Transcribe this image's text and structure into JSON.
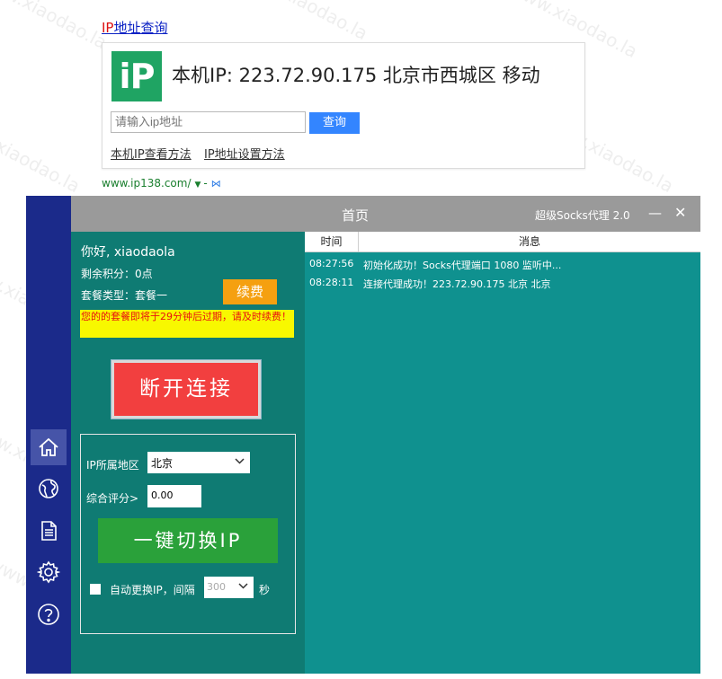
{
  "ip_page": {
    "title_prefix": "IP",
    "title_rest": "地址查询",
    "logo": "iP",
    "result": "本机IP: 223.72.90.175  北京市西城区 移动",
    "placeholder": "请输入ip地址",
    "query_label": "查询",
    "help_links": [
      "本机IP查看方法",
      "IP地址设置方法"
    ],
    "source_url": "www.ip138.com/",
    "source_sep": "-"
  },
  "app": {
    "title": "首页",
    "app_name": "超级Socks代理 2.0",
    "minimize": "—",
    "close": "✕",
    "greeting": "你好, xiaodaola",
    "points": "剩余积分：0点",
    "plan": "套餐类型：套餐一",
    "renew": "续费",
    "warning": "您的的套餐即将于29分钟后过期，请及时续费！",
    "disconnect": "断开连接",
    "region_label": "IP所属地区",
    "region_value": "北京",
    "score_label": "综合评分>",
    "score_value": "0.00",
    "switch_ip": "一键切换IP",
    "auto_label": "自动更换IP，间隔",
    "interval_value": "300",
    "seconds": "秒",
    "nav": [
      "home-icon",
      "globe-icon",
      "document-icon",
      "gear-icon",
      "help-icon"
    ],
    "log": {
      "headers": [
        "时间",
        "消息"
      ],
      "rows": [
        {
          "time": "08:27:56",
          "msg": "初始化成功！Socks代理端口 1080 监听中..."
        },
        {
          "time": "08:28:11",
          "msg": "连接代理成功！223.72.90.175 北京 北京"
        }
      ]
    }
  },
  "colors": {
    "teal": "#0f918f",
    "teal_dark": "#0f7b73",
    "sidebar": "#1b2a8a",
    "titlebar": "#9a9a9a",
    "renew": "#f5a010",
    "warn_bg": "#f8f800",
    "warn_fg": "#e81010",
    "disconnect": "#f23f3f",
    "switch": "#2aa13a",
    "query": "#3385ff",
    "logo": "#1fa463"
  },
  "watermark": "www.xiaodao.la"
}
